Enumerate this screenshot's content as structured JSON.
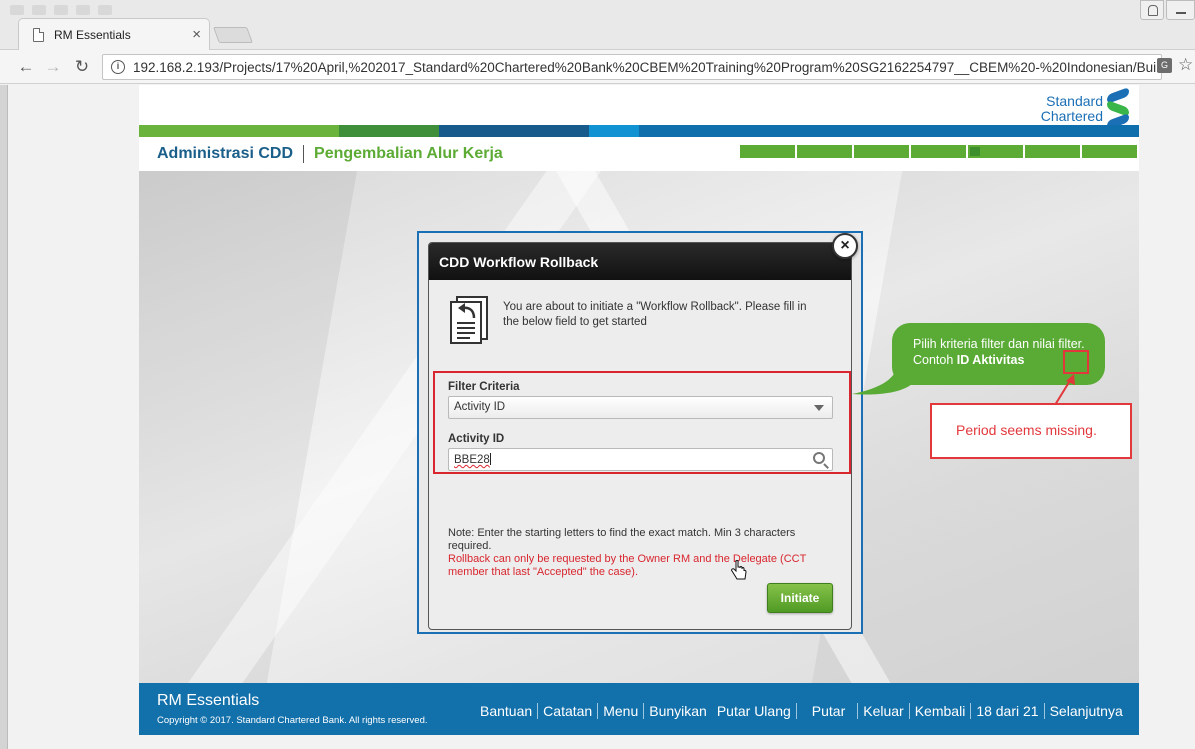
{
  "browser": {
    "tab_title": "RM Essentials",
    "tab_close": "×",
    "url": "192.168.2.193/Projects/17%20April,%202017_Standard%20Chartered%20Bank%20CBEM%20Training%20Program%20SG2162254797__CBEM%20-%20Indonesian/Buil"
  },
  "course": {
    "logo_line1": "Standard",
    "logo_line2": "Chartered",
    "heading_primary": "Administrasi CDD",
    "heading_secondary": "Pengembalian Alur Kerja",
    "progress_segments": 7,
    "colors": {
      "brand_blue": "#1270ab",
      "brand_green": "#5aab36",
      "alert_red": "#e2383c"
    }
  },
  "dialog": {
    "title": "CDD Workflow Rollback",
    "close_glyph": "×",
    "intro": "You are about to initiate a \"Workflow Rollback\". Please fill in the below field to get started",
    "filter_label": "Filter Criteria",
    "filter_value": "Activity ID",
    "activity_label": "Activity ID",
    "activity_value": "BBE28",
    "note": "Note: Enter the starting letters to find the exact match. Min 3 characters required.",
    "warning": "Rollback can only be requested by the Owner RM and the Delegate (CCT member that last \"Accepted\" the case).",
    "initiate_label": "Initiate"
  },
  "callout": {
    "text_plain": "Pilih kriteria filter dan nilai filter. Contoh ",
    "text_bold": "ID Aktivitas"
  },
  "review_comment": "Period seems missing.",
  "footer": {
    "title": "RM Essentials",
    "copyright": "Copyright © 2017. Standard Chartered Bank. All rights reserved.",
    "nav": {
      "help": "Bantuan",
      "notes": "Catatan",
      "menu": "Menu",
      "sound": "Bunyikan",
      "replay": "Putar Ulang",
      "play": "Putar",
      "exit": "Keluar",
      "back": "Kembali",
      "page_counter": "18 dari 21",
      "next": "Selanjutnya"
    }
  }
}
